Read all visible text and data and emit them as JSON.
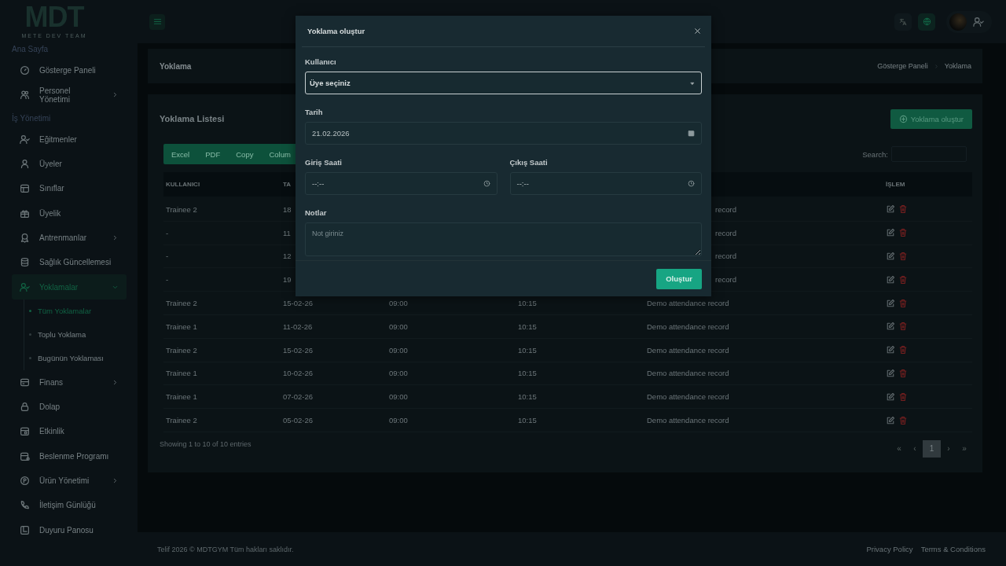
{
  "logo": {
    "mark": "MDT",
    "tagline": "METE DEV TEAM"
  },
  "sidebar": {
    "sections": [
      {
        "title": "Ana Sayfa",
        "items": [
          {
            "label": "Gösterge Paneli",
            "kind": "link",
            "selected": false
          },
          {
            "label": "Personel Yönetimi",
            "kind": "group",
            "selected": false,
            "expanded": false
          }
        ]
      },
      {
        "title": "İş Yönetimi",
        "items": [
          {
            "label": "Eğitmenler",
            "kind": "link",
            "selected": false
          },
          {
            "label": "Üyeler",
            "kind": "link",
            "selected": false
          },
          {
            "label": "Sınıflar",
            "kind": "link",
            "selected": false
          },
          {
            "label": "Üyelik",
            "kind": "link",
            "selected": false
          },
          {
            "label": "Antrenmanlar",
            "kind": "group",
            "selected": false,
            "expanded": false
          },
          {
            "label": "Sağlık Güncellemesi",
            "kind": "link",
            "selected": false
          },
          {
            "label": "Yoklamalar",
            "kind": "group",
            "selected": true,
            "expanded": true,
            "children": [
              {
                "label": "Tüm Yoklamalar",
                "selected": true
              },
              {
                "label": "Toplu Yoklama",
                "selected": false
              },
              {
                "label": "Bugünün Yoklaması",
                "selected": false
              }
            ]
          },
          {
            "label": "Finans",
            "kind": "group",
            "selected": false,
            "expanded": false
          },
          {
            "label": "Dolap",
            "kind": "link",
            "selected": false
          },
          {
            "label": "Etkinlik",
            "kind": "link",
            "selected": false
          },
          {
            "label": "Beslenme Programı",
            "kind": "link",
            "selected": false
          },
          {
            "label": "Ürün Yönetimi",
            "kind": "group",
            "selected": false,
            "expanded": false
          },
          {
            "label": "İletişim Günlüğü",
            "kind": "link",
            "selected": false
          },
          {
            "label": "Duyuru Panosu",
            "kind": "link",
            "selected": false
          }
        ]
      }
    ]
  },
  "breadcrumb": {
    "title": "Yoklama",
    "trail": [
      "Gösterge Paneli",
      "Yoklama"
    ]
  },
  "card": {
    "title": "Yoklama Listesi",
    "create_button": "Yoklama oluştur",
    "export_buttons": [
      "Excel",
      "PDF",
      "Copy",
      "Colum"
    ],
    "search_label": "Search:",
    "columns": [
      {
        "label": "KULLANICI",
        "kind": "text"
      },
      {
        "label": "TA",
        "kind": "text"
      },
      {
        "label": "İŞLEM",
        "kind": "actions"
      }
    ],
    "rows": [
      {
        "user": "Trainee 2",
        "date": "18",
        "note": "record",
        "covered": true
      },
      {
        "user": "-",
        "date": "11",
        "note": "record",
        "covered": true
      },
      {
        "user": "-",
        "date": "12",
        "note": "record",
        "covered": true
      },
      {
        "user": "-",
        "date": "19",
        "note": "record",
        "covered": true
      },
      {
        "user": "Trainee 2",
        "date": "15-02-26",
        "in": "09:00",
        "out": "10:15",
        "note": "Demo attendance record",
        "covered": false
      },
      {
        "user": "Trainee 1",
        "date": "11-02-26",
        "in": "09:00",
        "out": "10:15",
        "note": "Demo attendance record",
        "covered": false
      },
      {
        "user": "Trainee 2",
        "date": "15-02-26",
        "in": "09:00",
        "out": "10:15",
        "note": "Demo attendance record",
        "covered": false
      },
      {
        "user": "Trainee 1",
        "date": "10-02-26",
        "in": "09:00",
        "out": "10:15",
        "note": "Demo attendance record",
        "covered": false
      },
      {
        "user": "Trainee 1",
        "date": "07-02-26",
        "in": "09:00",
        "out": "10:15",
        "note": "Demo attendance record",
        "covered": false
      },
      {
        "user": "Trainee 2",
        "date": "05-02-26",
        "in": "09:00",
        "out": "10:15",
        "note": "Demo attendance record",
        "covered": false
      }
    ],
    "info": "Showing 1 to 10 of 10 entries",
    "pagination": [
      {
        "label": "«",
        "selected": false
      },
      {
        "label": "‹",
        "selected": false
      },
      {
        "label": "1",
        "selected": true
      },
      {
        "label": "›",
        "selected": false
      },
      {
        "label": "»",
        "selected": false
      }
    ]
  },
  "footer": {
    "copyright": "Telif 2026 © MDTGYM Tüm hakları saklıdır.",
    "links": [
      "Privacy Policy",
      "Terms & Conditions"
    ]
  },
  "modal": {
    "title": "Yoklama oluştur",
    "fields": [
      {
        "kind": "select",
        "label": "Kullanıcı",
        "value": "Üye seçiniz"
      },
      {
        "kind": "date",
        "label": "Tarih",
        "value": "21.02.2026"
      },
      {
        "kind": "time",
        "label": "Giriş Saati",
        "value": "--:--"
      },
      {
        "kind": "time",
        "label": "Çıkış Saati",
        "value": "--:--"
      },
      {
        "kind": "textarea",
        "label": "Notlar",
        "placeholder": "Not giriniz"
      }
    ],
    "submit": "Oluştur"
  }
}
